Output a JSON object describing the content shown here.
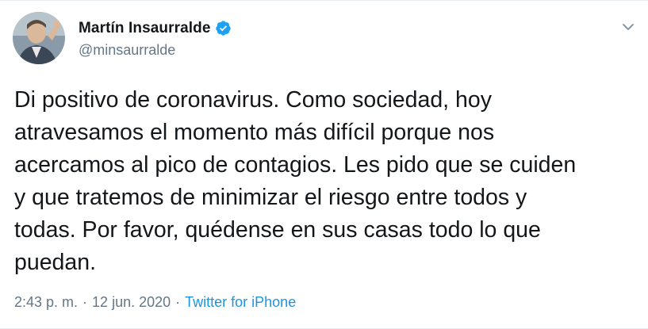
{
  "author": {
    "display_name": "Martín Insaurralde",
    "handle": "@minsaurralde",
    "verified": true,
    "verified_color": "#1da1f2"
  },
  "tweet": {
    "text": "Di positivo de coronavirus. Como sociedad, hoy\natravesamos el momento más difícil porque nos\nacercamos al pico de contagios. Les pido que se cuiden\ny que tratemos de minimizar el riesgo entre todos y\ntodas. Por favor, quédense en sus casas todo lo que\npuedan."
  },
  "meta": {
    "time": "2:43 p. m.",
    "separator": "·",
    "date": "12 jun. 2020",
    "separator2": "·",
    "source": "Twitter for iPhone"
  },
  "icons": {
    "more": "chevron-down-icon",
    "verified": "verified-badge-icon"
  },
  "colors": {
    "link": "#1b95e0",
    "muted": "#657786",
    "text": "#14171a"
  }
}
